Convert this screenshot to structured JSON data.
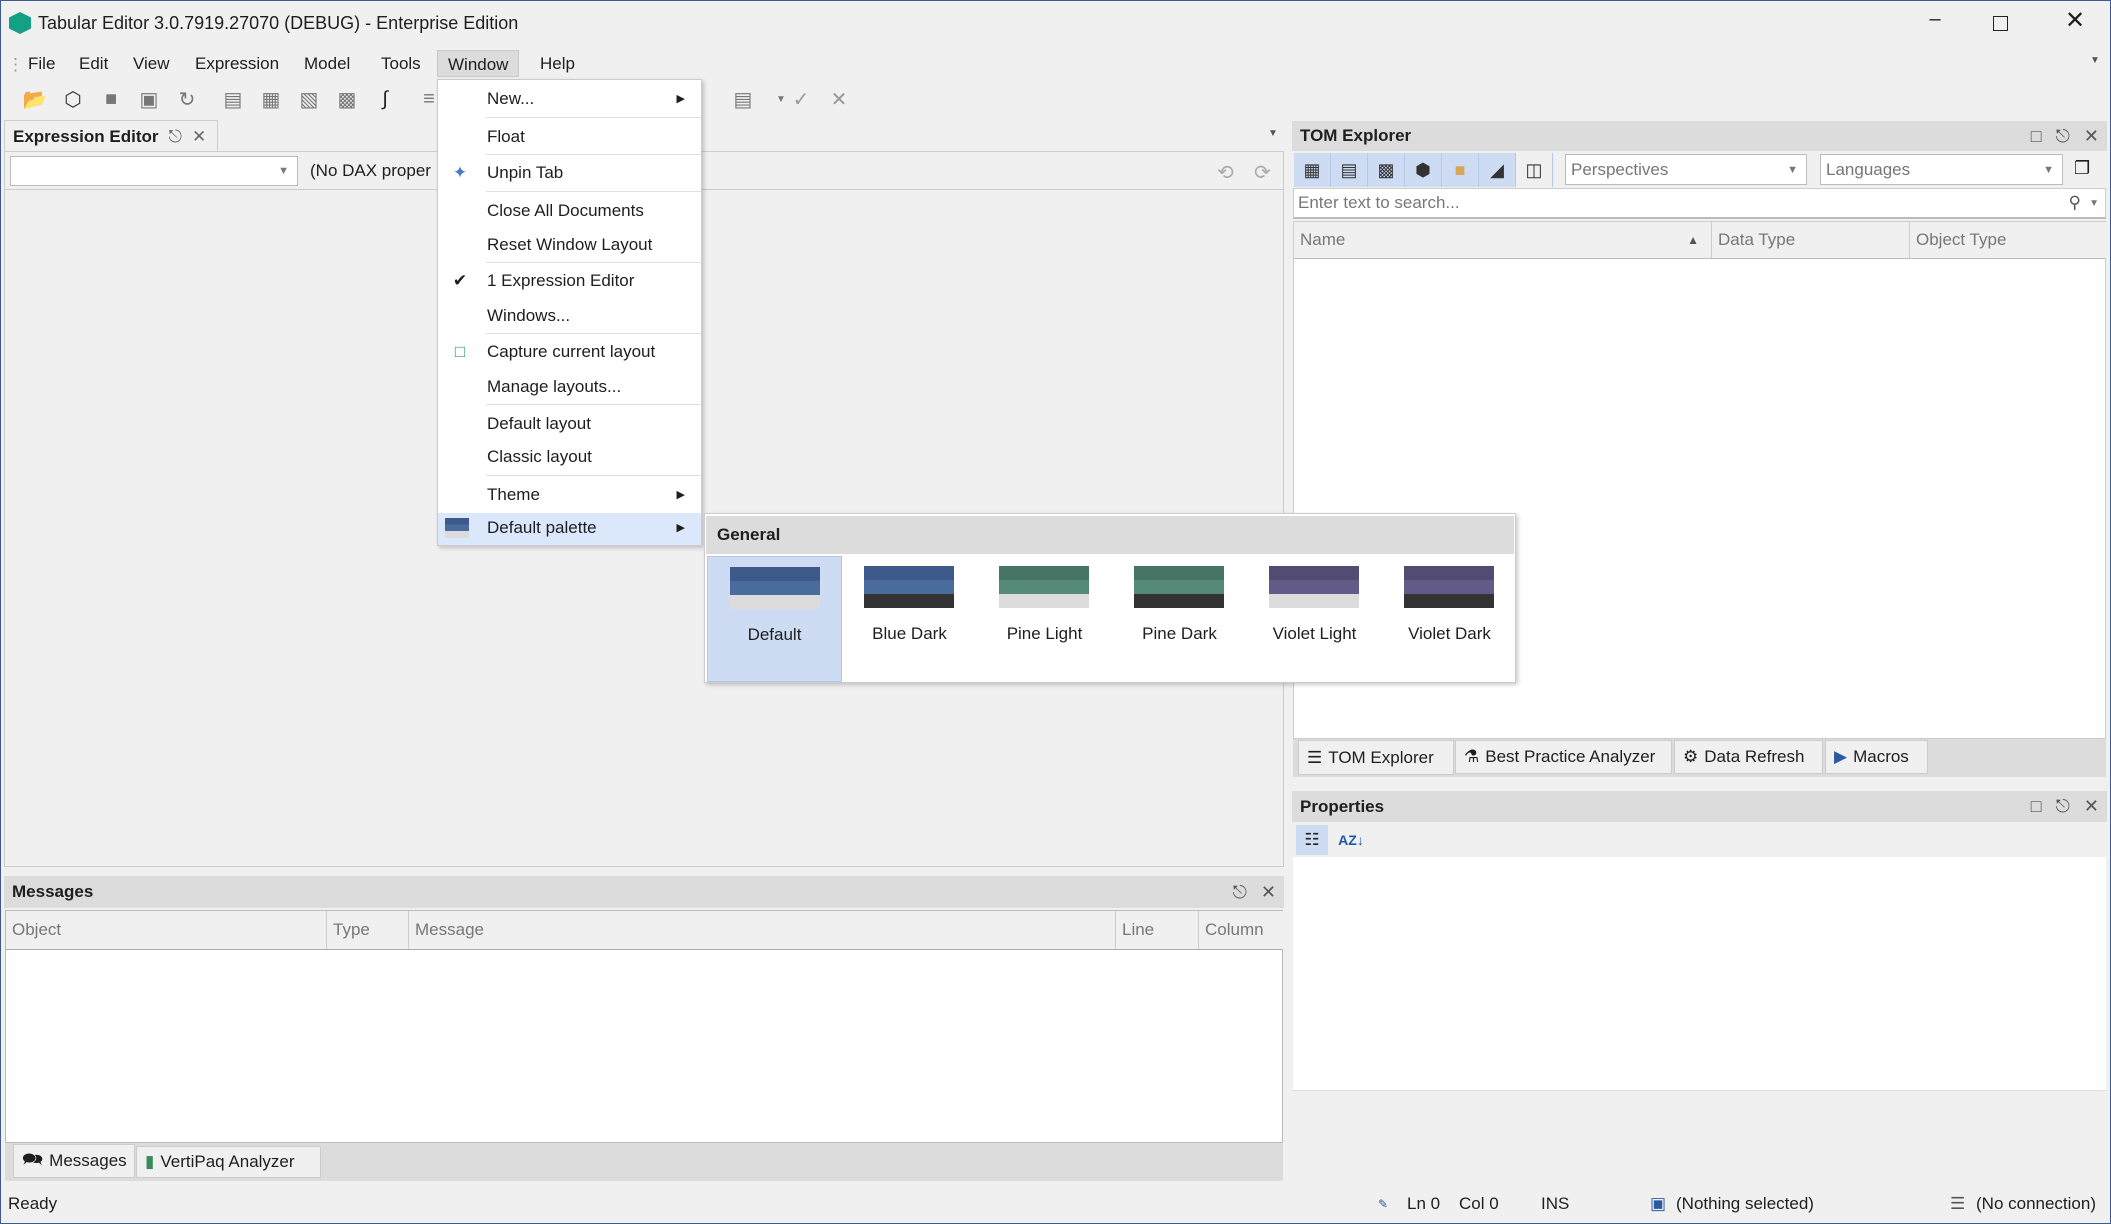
{
  "app": {
    "title": "Tabular Editor 3.0.7919.27070 (DEBUG) - Enterprise Edition",
    "accent": "#14a085"
  },
  "menu": [
    "File",
    "Edit",
    "View",
    "Expression",
    "Model",
    "Tools",
    "Window",
    "Help"
  ],
  "window_menu": {
    "items": [
      {
        "label": "New...",
        "submenu": true
      },
      {
        "label": "Float"
      },
      {
        "label": "Unpin Tab",
        "icon": "unpin-icon"
      },
      {
        "label": "Close All Documents"
      },
      {
        "label": "Reset Window Layout"
      },
      {
        "label": "1 Expression Editor",
        "checked": true
      },
      {
        "label": "Windows..."
      },
      {
        "label": "Capture current layout",
        "icon": "capture-layout-icon"
      },
      {
        "label": "Manage layouts..."
      },
      {
        "label": "Default layout"
      },
      {
        "label": "Classic layout"
      },
      {
        "label": "Theme",
        "submenu": true
      },
      {
        "label": "Default palette",
        "submenu": true,
        "highlighted": true,
        "icon": "palette-icon"
      }
    ]
  },
  "palette_submenu": {
    "group": "General",
    "palettes": [
      {
        "label": "Default",
        "selected": true,
        "colors": [
          "#3d5a8a",
          "#4a6b9e",
          "#dcdcdc"
        ]
      },
      {
        "label": "Blue Dark",
        "colors": [
          "#3d5a8a",
          "#4a6b9e",
          "#333333"
        ]
      },
      {
        "label": "Pine Light",
        "colors": [
          "#477565",
          "#548a77",
          "#dcdcdc"
        ]
      },
      {
        "label": "Pine Dark",
        "colors": [
          "#477565",
          "#548a77",
          "#333333"
        ]
      },
      {
        "label": "Violet Light",
        "colors": [
          "#524b72",
          "#625b88",
          "#dcdcdc"
        ]
      },
      {
        "label": "Violet Dark",
        "colors": [
          "#524b72",
          "#625b88",
          "#333333"
        ]
      }
    ]
  },
  "expression_editor": {
    "tab": "Expression Editor",
    "property_combo": "",
    "dax_property": "(No DAX proper"
  },
  "messages": {
    "title": "Messages",
    "columns": [
      "Object",
      "Type",
      "Message",
      "Line",
      "Column"
    ],
    "tabs": [
      "Messages",
      "VertiPaq Analyzer"
    ]
  },
  "tom_explorer": {
    "title": "TOM Explorer",
    "perspectives": "Perspectives",
    "languages": "Languages",
    "search_placeholder": "Enter text to search...",
    "columns": [
      "Name",
      "Data Type",
      "Object Type"
    ],
    "tabs": [
      "TOM Explorer",
      "Best Practice Analyzer",
      "Data Refresh",
      "Macros"
    ]
  },
  "properties": {
    "title": "Properties"
  },
  "status": {
    "ready": "Ready",
    "ln": "Ln 0",
    "col": "Col 0",
    "mode": "INS",
    "selection": "(Nothing selected)",
    "connection": "(No connection)"
  }
}
